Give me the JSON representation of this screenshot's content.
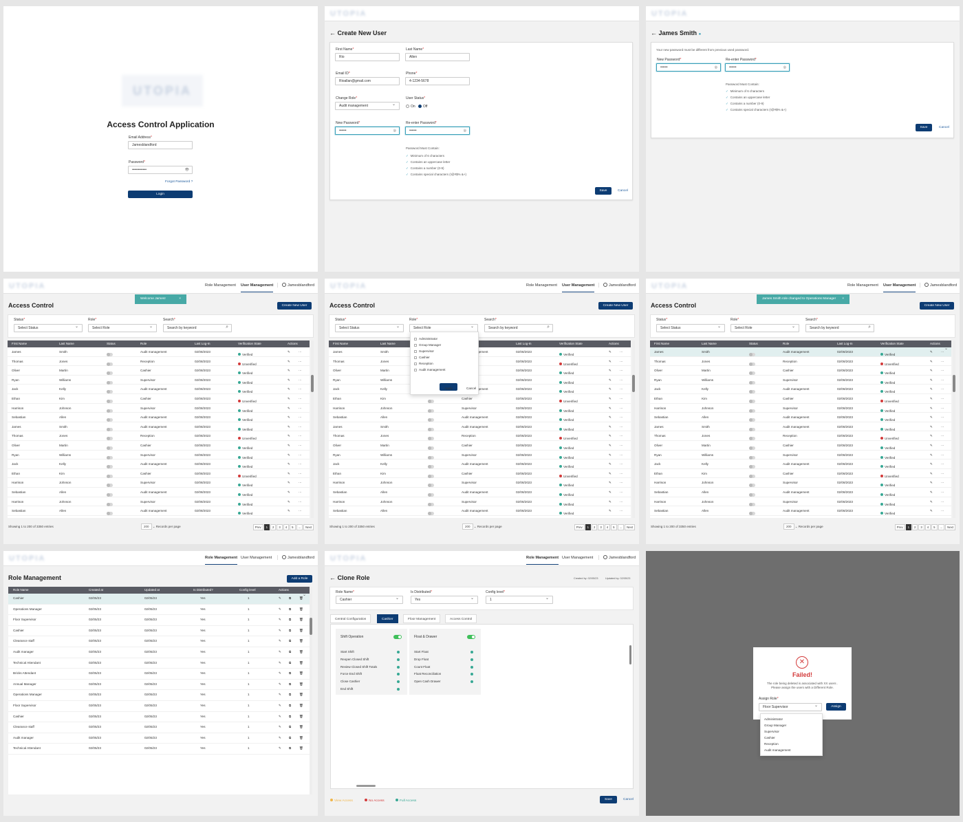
{
  "login": {
    "logo": "UTOPIA",
    "title": "Access Control Application",
    "email_label": "Email Address",
    "email": "Jamesblandford",
    "password_label": "Password",
    "password": "••••••••••••",
    "forgot": "Forgot Password ?",
    "login": "Login"
  },
  "create_user": {
    "logo": "UTOPIA",
    "title": "Create New User",
    "first_label": "First Name",
    "first": "Rio",
    "last_label": "Last Name",
    "last": "Allen",
    "email_label": "Email ID",
    "email": "Rioallan@gmail.com",
    "phone_label": "Phone",
    "phone": "4-1234-5678",
    "role_label": "Change Role",
    "role": "Audit management",
    "status_label": "User Status",
    "on": "On",
    "off": "Off",
    "newpw_label": "New Password",
    "newpw": "••••••",
    "repw_label": "Re-enter Password",
    "repw": "••••••",
    "rules_title": "Password Must Contain:",
    "rules": [
      "Minimum of 6 characters",
      "Contains an uppercase letter",
      "Contains a number (0-9)",
      "Contains special characters (!@#$% &+)"
    ],
    "save": "Save",
    "cancel": "Cancel"
  },
  "reset_pw": {
    "logo": "UTOPIA",
    "title": "James Smith",
    "note": "Your new password must be different from previous used password.",
    "newpw_label": "New Password",
    "newpw": "••••••",
    "repw_label": "Re-enter Password",
    "repw": "••••••",
    "rules_title": "Password Must Contain:",
    "rules": [
      "Minimum of 6 characters",
      "Contains an uppercase letter",
      "Contains a number (0-9)",
      "Contains special characters (!@#$% &+)"
    ],
    "save": "Save",
    "cancel": "Cancel"
  },
  "nav": {
    "logo": "UTOPIA",
    "role_mgmt": "Role Management",
    "user_mgmt": "User Management",
    "user": "Jamesblandford"
  },
  "access": {
    "title": "Access Control",
    "create": "Create New User",
    "status_label": "Status",
    "status_ph": "Select Status",
    "role_label": "Role",
    "role_ph": "Select Role",
    "search_label": "Search",
    "search_ph": "Search by keyword",
    "columns": [
      "First Name",
      "Last Name",
      "Status",
      "Role",
      "Last Log-In",
      "Verification State",
      "Actions"
    ],
    "rows": [
      [
        "James",
        "Smith",
        "Audit management",
        "02/08/2023",
        "Verified"
      ],
      [
        "Thomas",
        "Jones",
        "Reception",
        "02/08/2023",
        "Unverified"
      ],
      [
        "Oliver",
        "Martin",
        "Cashier",
        "02/08/2023",
        "Verified"
      ],
      [
        "Ryan",
        "Williams",
        "Supervisor",
        "02/08/2023",
        "Verified"
      ],
      [
        "Jack",
        "Kelly",
        "Audit management",
        "02/08/2023",
        "Verified"
      ],
      [
        "Ethan",
        "Kim",
        "Cashier",
        "02/08/2023",
        "Unverified"
      ],
      [
        "Harrison",
        "Johnson",
        "Supervisor",
        "02/08/2023",
        "Verified"
      ],
      [
        "Sebastian",
        "Allen",
        "Audit management",
        "02/08/2023",
        "Verified"
      ],
      [
        "James",
        "Smith",
        "Audit management",
        "02/08/2023",
        "Verified"
      ],
      [
        "Thomas",
        "Jones",
        "Reception",
        "02/08/2023",
        "Unverified"
      ],
      [
        "Oliver",
        "Martin",
        "Cashier",
        "02/08/2023",
        "Verified"
      ],
      [
        "Ryan",
        "Williams",
        "Supervisor",
        "02/08/2023",
        "Verified"
      ],
      [
        "Jack",
        "Kelly",
        "Audit management",
        "02/08/2023",
        "Verified"
      ],
      [
        "Ethan",
        "Kim",
        "Cashier",
        "02/08/2023",
        "Unverified"
      ],
      [
        "Harrison",
        "Johnson",
        "Supervisor",
        "02/08/2023",
        "Verified"
      ],
      [
        "Sebastian",
        "Allen",
        "Audit management",
        "02/08/2023",
        "Verified"
      ],
      [
        "Harrison",
        "Johnson",
        "Supervisor",
        "02/08/2023",
        "Verified"
      ],
      [
        "Sebastian",
        "Allen",
        "Audit management",
        "02/08/2023",
        "Verified"
      ]
    ],
    "showing": "Showing 1 to 200 of 3350 entries",
    "per_page": "200",
    "per_page_label": "Records per page",
    "pages": [
      "Prev",
      "1",
      "2",
      "3",
      "4",
      "5",
      "...",
      "Next"
    ]
  },
  "toasts": {
    "welcome": "Welcome James!",
    "changed": "James Smith role changed to Operations Manager"
  },
  "role_filter": {
    "options": [
      "Administrator",
      "Group Manager",
      "Supervisor",
      "Cashier",
      "Reception",
      "Audit management"
    ],
    "apply": "Apply",
    "cancel": "Cancel"
  },
  "roles": {
    "title": "Role Management",
    "add": "Add a Role",
    "columns": [
      "Role Name",
      "Created at",
      "Updated at",
      "Is Distributed?",
      "Config level",
      "Actions"
    ],
    "rows": [
      "Cashier",
      "Operations Manager",
      "Floor Supervisor",
      "Cashier",
      "Clearance staff",
      "Audit manager",
      "Technical Attendant",
      "Bricks Attendant",
      "Annual Manager",
      "Operations Manager",
      "Floor Supervisor",
      "Cashier",
      "Clearance staff",
      "Audit manager",
      "Technical Attendant"
    ],
    "created": "02/05/23",
    "updated": "02/05/23",
    "dist": "Yes",
    "level": "1"
  },
  "clone": {
    "title": "Clone Role",
    "created": "Created by: 02/05/23",
    "updated": "Updated by: 02/05/23",
    "name_label": "Role Name",
    "name": "Cashier",
    "dist_label": "Is Distributed",
    "dist": "Yes",
    "cfg_label": "Config level",
    "cfg": "1",
    "tabs": [
      "Central Configuration",
      "Cashier",
      "Floor Management",
      "Access Control"
    ],
    "shift": {
      "title": "Shift Operation",
      "items": [
        "Start Shift",
        "Reopen Closed Shift",
        "Review Closed Shift Totals",
        "Force End Shift",
        "Close Cashier",
        "End Shift"
      ]
    },
    "float": {
      "title": "Float & Drawer",
      "items": [
        "Start Float",
        "Drop Float",
        "Count Float",
        "Float Reconciliation",
        "Open Cash Drawer"
      ]
    },
    "legend": [
      "View Access",
      "No Access",
      "Full Access"
    ],
    "save": "Save",
    "cancel": "Cancel"
  },
  "failed": {
    "title": "Failed!",
    "msg1": "The role being deleted is associated with XX users .",
    "msg2": "Please assign the users with a Different Role.",
    "assign_label": "Assign Role",
    "assign_val": "Floor Supervisor",
    "assign": "Assign",
    "options": [
      "Administrator",
      "Group Manager",
      "Supervisor",
      "Cashier",
      "Reception",
      "Audit management"
    ]
  },
  "colors": {
    "primary": "#0d3c73",
    "teal": "#47a9a6",
    "verified": "#37a894",
    "unverified": "#d33a3a",
    "overlay": "#6e6e6e"
  }
}
